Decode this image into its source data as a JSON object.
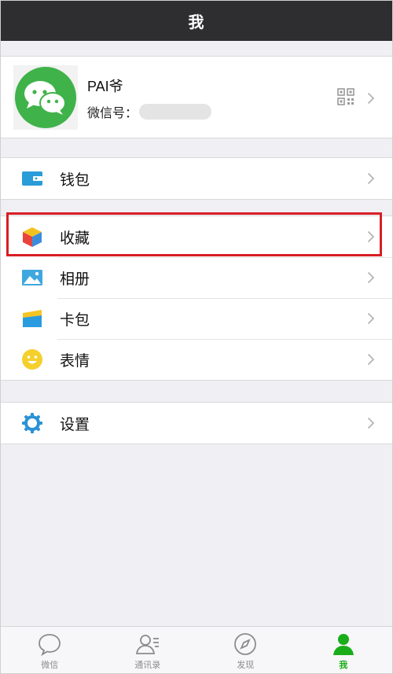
{
  "header": {
    "title": "我"
  },
  "profile": {
    "name": "PAI爷",
    "wechat_id_label": "微信号："
  },
  "menu": {
    "wallet": "钱包",
    "favorites": "收藏",
    "album": "相册",
    "cards": "卡包",
    "stickers": "表情",
    "settings": "设置"
  },
  "tabbar": {
    "tabs": [
      {
        "label": "微信",
        "icon": "chat-bubble-icon"
      },
      {
        "label": "通讯录",
        "icon": "contacts-icon"
      },
      {
        "label": "发现",
        "icon": "compass-icon"
      },
      {
        "label": "我",
        "icon": "person-icon",
        "active": true
      }
    ]
  },
  "colors": {
    "header_bg": "#2e2e30",
    "accent_green": "#1aad19",
    "highlight_red": "#d81e24",
    "background": "#efeff4"
  }
}
